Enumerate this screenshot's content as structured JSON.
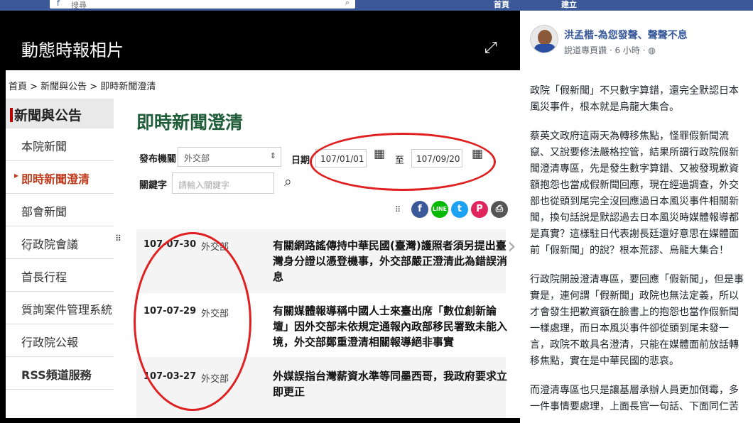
{
  "fb_topbar": {
    "search_placeholder": "搜尋",
    "home_label": "首頁",
    "create_label": "建立"
  },
  "viewer": {
    "title": "動態時報相片"
  },
  "photo": {
    "breadcrumb": "首頁 > 新聞與公告 > 即時新聞澄清",
    "sidebar": {
      "heading": "新聞與公告",
      "items": [
        {
          "label": "本院新聞",
          "active": false
        },
        {
          "label": "即時新聞澄清",
          "active": true
        },
        {
          "label": "部會新聞",
          "active": false
        },
        {
          "label": "行政院會議",
          "active": false
        },
        {
          "label": "首長行程",
          "active": false
        },
        {
          "label": "質詢案件管理系統",
          "active": false
        },
        {
          "label": "行政院公報",
          "active": false
        },
        {
          "label": "RSS頻道服務",
          "active": false
        }
      ]
    },
    "main_title": "即時新聞澄清",
    "filter": {
      "agency_label": "發布機關",
      "agency_value": "外交部",
      "date_label": "日期",
      "date_from": "107/01/01",
      "date_sep": "至",
      "date_to": "107/09/20",
      "keyword_label": "關鍵字",
      "keyword_placeholder": "請輸入關鍵字"
    },
    "share_icons": [
      "facebook-icon",
      "line-icon",
      "twitter-icon",
      "plurk-icon",
      "print-icon"
    ],
    "news": [
      {
        "date": "107-07-30",
        "dept": "外交部",
        "title": "有關網路謠傳持中華民國(臺灣)護照者須另提出臺灣身分證以憑登機事，外交部嚴正澄清此為錯誤消息"
      },
      {
        "date": "107-07-29",
        "dept": "外交部",
        "title": "有關媒體報導稱中國人士來臺出席「數位創新論壇」因外交部未依規定通報內政部移民署致未能入境，外交部鄭重澄清相關報導絕非事實"
      },
      {
        "date": "107-03-27",
        "dept": "外交部",
        "title": "外媒誤指台灣薪資水準等同墨西哥，我政府要求立即更正"
      }
    ],
    "accent_color": "#1f5d39",
    "highlight_color": "#e02020"
  },
  "post": {
    "author": "洪孟楷-為您發聲、聲聲不息",
    "meta": "說道專頁讚 · 6 小時 ·",
    "paragraphs": [
      "政院「假新聞」不只數字算錯，還完全默認日本風災事件，根本就是烏龍大集合。",
      "蔡英文政府這兩天為轉移焦點，怪罪假新聞流竄、又說要修法嚴格控管，結果所謂行政院假新聞澄清專區，先是發生數字算錯、又被發現歉資額抱怨也當成假新聞回應，現在經過調查，外交部也從頭到尾完全沒回應過日本風災事件相關新聞，換句話說是默認過去日本風災時媒體報導都是真實？這樣駐日代表謝長廷還好意思在媒體面前「假新聞」的說？根本荒謬、烏龍大集合！",
      "行政院開設澄清專區，要回應「假新聞」，但是事實是，連何謂「假新聞」政院也無法定義，所以才會發生把歉資額在臉書上的抱怨也當作假新聞一樣處理，而日本風災事件卻從頭到尾未發一言，政院不敢具名澄清，只能在媒體面前放話轉移焦點，實在是中華民國的悲哀。",
      "而澄清專區也只是讓基層承辦人員更加倒霉，多一件事情要處理，上面長官一句話、下面同仁苦"
    ]
  }
}
